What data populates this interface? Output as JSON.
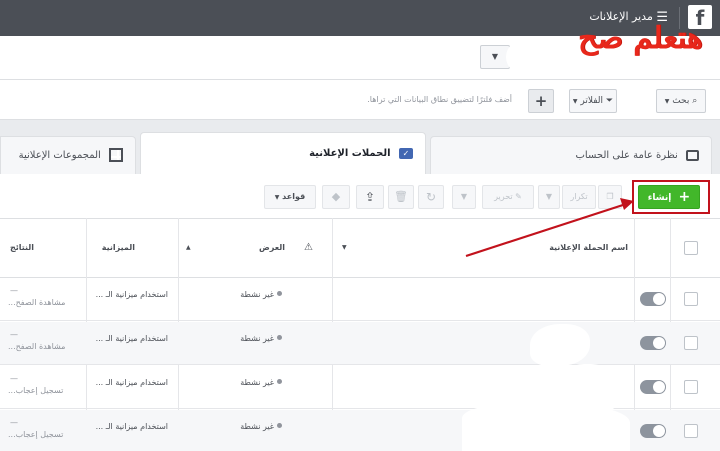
{
  "topbar": {
    "logo": "f",
    "title": "مدير الإعلانات",
    "menu_icon": "hamburger-icon"
  },
  "annotation": {
    "scribble_text": "هتعلم صح",
    "color": "#c2121c"
  },
  "account": {
    "dropdown_arrow": "▼"
  },
  "search": {
    "search_label": "بحث",
    "filters_label": "الفلاتر",
    "placeholder": "أضف فلترًا لتضييق نطاق البيانات التي تراها.",
    "add_label": "+"
  },
  "tabs": {
    "overview": "نظرة عامة على الحساب",
    "campaigns": "الحملات الإعلانية",
    "adsets": "المجموعات الإعلانية"
  },
  "toolbar": {
    "create_label": "إنشاء",
    "duplicate_label": "تكرار",
    "edit_label": "تحرير",
    "rules_label": "قواعد"
  },
  "table": {
    "headers": {
      "campaign_name": "اسم الحملة الإعلانية",
      "delivery": "العرض",
      "budget": "الميزانية",
      "results": "النتائج"
    },
    "rows": [
      {
        "delivery": "غير نشطة",
        "budget": "استخدام ميزانية الـ ...",
        "results_dash": "—",
        "results": "مشاهدة الصفح..."
      },
      {
        "delivery": "غير نشطة",
        "budget": "استخدام ميزانية الـ ...",
        "results_dash": "—",
        "results": "مشاهدة الصفح..."
      },
      {
        "delivery": "غير نشطة",
        "budget": "استخدام ميزانية الـ ...",
        "results_dash": "—",
        "results": "تسجيل إعجاب..."
      },
      {
        "delivery": "غير نشطة",
        "budget": "استخدام ميزانية الـ ...",
        "results_dash": "—",
        "results": "تسجيل إعجاب..."
      }
    ]
  },
  "colors": {
    "topbar": "#4b4f56",
    "create_button": "#42b72a",
    "annotation_red": "#c2121c",
    "scribble_red": "#e8281c",
    "link_blue": "#4267b2"
  }
}
